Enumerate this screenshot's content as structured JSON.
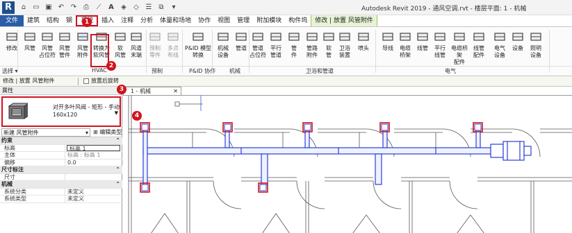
{
  "window": {
    "title": "Autodesk Revit 2019 - 通风空调.rvt - 楼层平面: 1 - 机械"
  },
  "menu": {
    "tabs": [
      "文件",
      "建筑",
      "结构",
      "钢",
      "系统",
      "插入",
      "注释",
      "分析",
      "体量和场地",
      "协作",
      "视图",
      "管理",
      "附加模块",
      "构件坞",
      "修改 | 放置 风管附件"
    ]
  },
  "ribbon": {
    "buttons": [
      {
        "label": "修改",
        "icon": "cursor-icon"
      },
      {
        "label": "风管",
        "icon": "duct-icon"
      },
      {
        "label": "风管\n占位符",
        "icon": "duct-placeholder-icon"
      },
      {
        "label": "风管\n管件",
        "icon": "duct-fitting-icon"
      },
      {
        "label": "风管\n附件",
        "icon": "duct-accessory-icon"
      },
      {
        "label": "转换为\n软风管",
        "icon": "convert-flex-icon"
      },
      {
        "label": "软\n风管",
        "icon": "flex-duct-icon"
      },
      {
        "label": "风道\n末端",
        "icon": "air-terminal-icon"
      },
      {
        "label": "预制\n零件",
        "icon": "fabrication-icon"
      },
      {
        "label": "多点\n布线",
        "icon": "multipoint-routing-icon"
      },
      {
        "label": "P&ID 模型转换",
        "icon": "pid-icon"
      },
      {
        "label": "机械\n设备",
        "icon": "mechanical-equipment-icon"
      },
      {
        "label": "管道",
        "icon": "pipe-icon"
      },
      {
        "label": "管道\n占位符",
        "icon": "pipe-placeholder-icon"
      },
      {
        "label": "平行\n管道",
        "icon": "parallel-pipes-icon"
      },
      {
        "label": "管\n件",
        "icon": "pipe-fitting-icon"
      },
      {
        "label": "管路\n附件",
        "icon": "pipe-accessory-icon"
      },
      {
        "label": "软\n管",
        "icon": "flex-pipe-icon"
      },
      {
        "label": "卫浴\n装置",
        "icon": "plumbing-fixture-icon"
      },
      {
        "label": "喷头",
        "icon": "sprinkler-icon"
      },
      {
        "label": "导线",
        "icon": "wire-icon"
      },
      {
        "label": "电缆\n桥架",
        "icon": "cable-tray-icon"
      },
      {
        "label": "线管",
        "icon": "conduit-icon"
      },
      {
        "label": "平行\n线管",
        "icon": "parallel-conduits-icon"
      },
      {
        "label": "电缆桥架\n配件",
        "icon": "cable-tray-fitting-icon"
      },
      {
        "label": "线管\n配件",
        "icon": "conduit-fitting-icon"
      },
      {
        "label": "电气\n设备",
        "icon": "electrical-equipment-icon"
      },
      {
        "label": "设备",
        "icon": "device-icon"
      },
      {
        "label": "照明\n设备",
        "icon": "lighting-fixture-icon"
      }
    ],
    "panels": [
      "选择 ▾",
      "HVAC",
      "预制",
      "P&ID 协作",
      "机械",
      "卫浴和管道",
      "电气"
    ]
  },
  "context_bar": {
    "label": "修改 | 放置 风管附件",
    "checkbox_label": "放置后旋转"
  },
  "properties": {
    "header": "属性",
    "type_name": "对开多叶风阀 - 矩形 - 手动\n160x120",
    "instance_select": "新建 风管附件",
    "edit_type": "编辑类型",
    "sections": [
      {
        "title": "约束",
        "rows": [
          {
            "key": "标高",
            "value": "标高 1",
            "boxed": true
          },
          {
            "key": "主体",
            "value": "标高 : 标高 1",
            "gray": true
          },
          {
            "key": "偏移",
            "value": "0.0"
          }
        ]
      },
      {
        "title": "尺寸标注",
        "rows": [
          {
            "key": "尺寸",
            "value": ""
          }
        ]
      },
      {
        "title": "机械",
        "rows": [
          {
            "key": "系统分类",
            "value": "未定义"
          },
          {
            "key": "系统类型",
            "value": "未定义"
          }
        ]
      }
    ]
  },
  "view": {
    "tab": "1 - 机械",
    "close": "✕"
  },
  "callouts": [
    "1",
    "2",
    "3",
    "4"
  ],
  "colors": {
    "accent_red": "#d0131d",
    "duct_blue": "#2a3fd6",
    "file_tab": "#2a5da6"
  }
}
